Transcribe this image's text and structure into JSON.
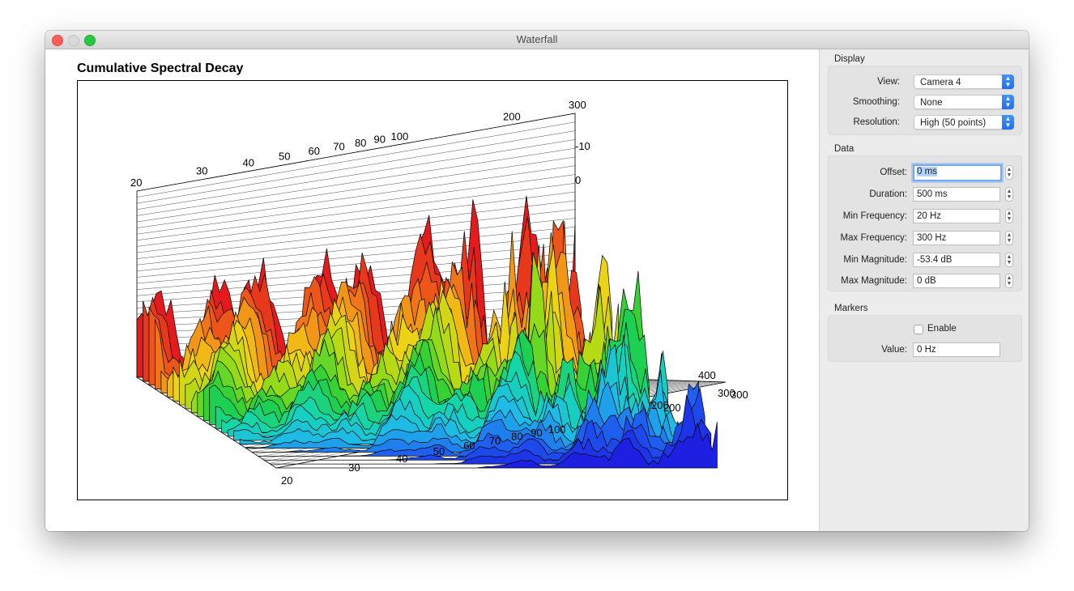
{
  "window": {
    "title": "Waterfall"
  },
  "chart": {
    "title": "Cumulative Spectral Decay"
  },
  "chart_data": {
    "type": "area",
    "title": "Cumulative Spectral Decay",
    "frequency_ticks": [
      "20",
      "30",
      "40",
      "50",
      "60",
      "70",
      "80",
      "90",
      "100",
      "200",
      "300"
    ],
    "magnitude_ticks": [
      "-10",
      "0"
    ],
    "time_ticks": [
      "400",
      "300",
      "200"
    ],
    "colormap": [
      "#e41a1c",
      "#f07018",
      "#f3d215",
      "#a7dc14",
      "#1fcf3c",
      "#15d6b6",
      "#1fb8e8",
      "#1e5bf0",
      "#1d20e0"
    ],
    "slices": 24,
    "frequency_range": [
      20,
      300
    ]
  },
  "sidebar": {
    "display": {
      "label": "Display",
      "view_label": "View:",
      "view_value": "Camera 4",
      "smoothing_label": "Smoothing:",
      "smoothing_value": "None",
      "resolution_label": "Resolution:",
      "resolution_value": "High (50 points)"
    },
    "data": {
      "label": "Data",
      "offset_label": "Offset:",
      "offset_value": "0 ms",
      "duration_label": "Duration:",
      "duration_value": "500 ms",
      "min_freq_label": "Min Frequency:",
      "min_freq_value": "20 Hz",
      "max_freq_label": "Max Frequency:",
      "max_freq_value": "300 Hz",
      "min_mag_label": "Min Magnitude:",
      "min_mag_value": "-53.4 dB",
      "max_mag_label": "Max Magnitude:",
      "max_mag_value": "0 dB"
    },
    "markers": {
      "label": "Markers",
      "enable_label": "Enable",
      "value_label": "Value:",
      "value_value": "0 Hz"
    }
  }
}
